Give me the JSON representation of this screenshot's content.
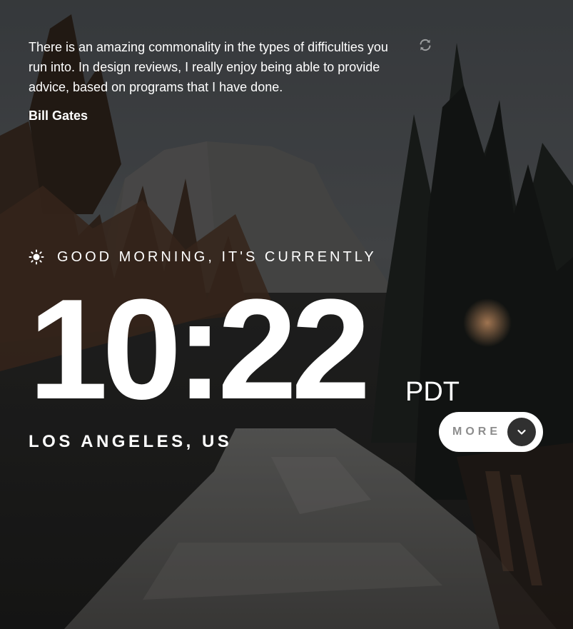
{
  "quote": {
    "text": "There is an amazing commonality in the types of difficulties you run into. In design reviews, I really enjoy being able to provide advice, based on programs that I have done.",
    "author": "Bill Gates",
    "refresh_icon": "refresh-icon"
  },
  "clock": {
    "greeting": "GOOD MORNING, IT'S CURRENTLY",
    "greeting_icon": "sun-icon",
    "time": "10:22",
    "timezone": "PDT",
    "location": "LOS ANGELES, US"
  },
  "more_button": {
    "label": "MORE",
    "icon": "chevron-down-icon"
  },
  "colors": {
    "text": "#ffffff",
    "button_bg": "#ffffff",
    "button_text": "#303030",
    "button_circle": "#303030"
  }
}
